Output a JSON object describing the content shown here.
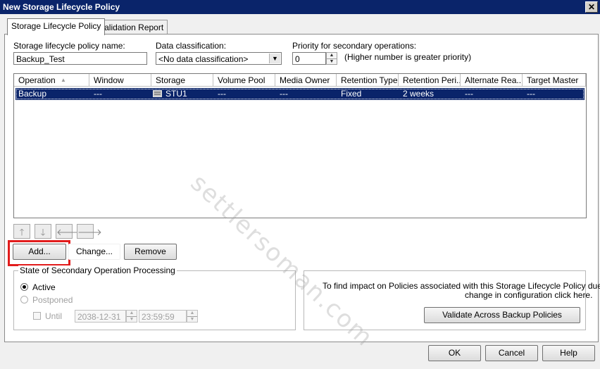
{
  "window": {
    "title": "New Storage Lifecycle Policy",
    "close_glyph": "✕"
  },
  "tabs": [
    {
      "label": "Storage Lifecycle Policy",
      "active": true
    },
    {
      "label": "Validation Report",
      "active": false
    }
  ],
  "form": {
    "policy_name_label": "Storage lifecycle policy name:",
    "policy_name_value": "Backup_Test",
    "data_class_label": "Data classification:",
    "data_class_value": "<No data classification>",
    "priority_label": "Priority for secondary operations:",
    "priority_value": "0",
    "priority_hint": "(Higher number is greater priority)"
  },
  "table": {
    "columns": [
      "Operation",
      "Window",
      "Storage",
      "Volume Pool",
      "Media Owner",
      "Retention Type",
      "Retention Peri...",
      "Alternate Rea...",
      "Target Master"
    ],
    "sort_glyph": "▲",
    "rows": [
      {
        "operation": "Backup",
        "window": "---",
        "storage": "STU1",
        "volume_pool": "---",
        "media_owner": "---",
        "retention_type": "Fixed",
        "retention_period": "2 weeks",
        "alternate_read": "---",
        "target_master": "---"
      }
    ]
  },
  "move_buttons": {
    "up": "🡑",
    "down": "🡓",
    "left": "🡐",
    "right": "🡒"
  },
  "buttons": {
    "add": "Add...",
    "change": "Change...",
    "remove": "Remove"
  },
  "state_group": {
    "title": "State of Secondary Operation Processing",
    "active_label": "Active",
    "postponed_label": "Postponed",
    "until_label": "Until",
    "until_date": "2038-12-31",
    "until_time": "23:59:59"
  },
  "impact_group": {
    "text_line1": "To find impact on Policies associated with this Storage Lifecycle Policy due to",
    "text_line2": "change in configuration click here.",
    "validate_button": "Validate Across Backup Policies"
  },
  "footer": {
    "ok": "OK",
    "cancel": "Cancel",
    "help": "Help"
  },
  "watermark": "settlersoman.com",
  "colors": {
    "title_bar": "#0a246a",
    "selection": "#0a246a",
    "highlight_box": "#e21c1c"
  }
}
